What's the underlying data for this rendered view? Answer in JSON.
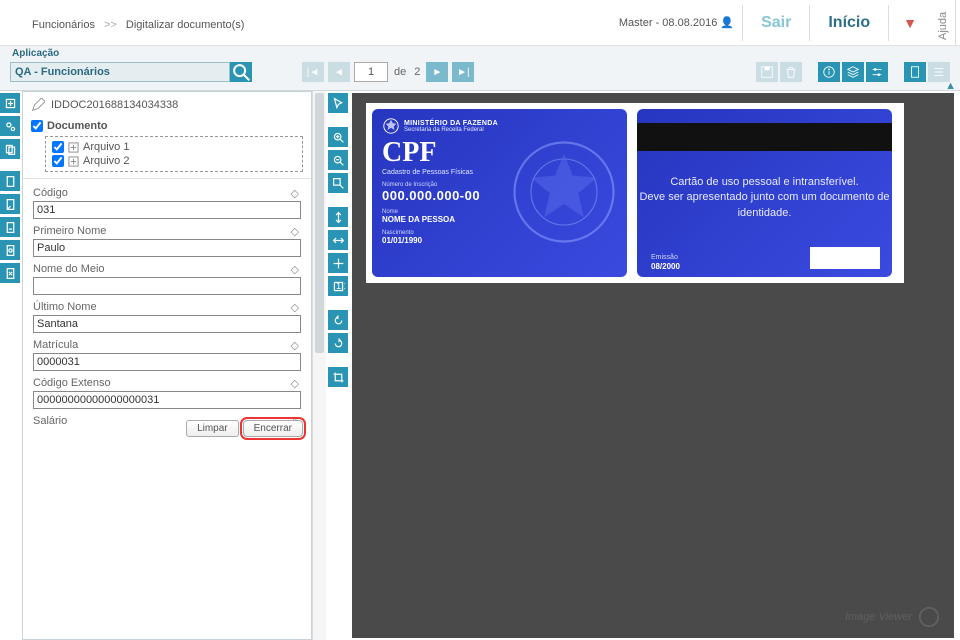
{
  "header": {
    "breadcrumb_root": "Funcionários",
    "breadcrumb_sep": ">>",
    "breadcrumb_page": "Digitalizar documento(s)",
    "user": "Master - 08.08.2016",
    "btn_sair": "Sair",
    "btn_inicio": "Início",
    "ajuda": "Ajuda"
  },
  "subbar": {
    "app_label": "Aplicação",
    "app_value": "QA - Funcionários",
    "page_current": "1",
    "page_of": "de",
    "page_total": "2"
  },
  "doc": {
    "id": "IDDOC201688134034338",
    "node": "Documento",
    "files": [
      "Arquivo 1",
      "Arquivo 2"
    ]
  },
  "form": {
    "codigo": {
      "label": "Código",
      "value": "031"
    },
    "primeiro": {
      "label": "Primeiro Nome",
      "value": "Paulo"
    },
    "meio": {
      "label": "Nome do Meio",
      "value": ""
    },
    "ultimo": {
      "label": "Último Nome",
      "value": "Santana"
    },
    "matricula": {
      "label": "Matrícula",
      "value": "0000031"
    },
    "codext": {
      "label": "Código Extenso",
      "value": "00000000000000000031"
    },
    "salario": {
      "label": "Salário",
      "value": ""
    },
    "btn_limpar": "Limpar",
    "btn_encerrar": "Encerrar"
  },
  "cpf": {
    "ministerio": "MINISTÉRIO DA FAZENDA",
    "secretaria": "Secretaria da Receita Federal",
    "title": "CPF",
    "subtitle": "Cadastro de Pessoas Físicas",
    "num_lbl": "Número de Inscrição",
    "num": "000.000.000-00",
    "nome_lbl": "Nome",
    "nome": "NOME DA PESSOA",
    "nasc_lbl": "Nascimento",
    "nasc": "01/01/1990",
    "back1": "Cartão de uso pessoal e intransferível.",
    "back2": "Deve ser apresentado junto com um documento de identidade.",
    "em_lbl": "Emissão",
    "em": "08/2000"
  },
  "viewer": {
    "watermark": "Image Viewer"
  }
}
